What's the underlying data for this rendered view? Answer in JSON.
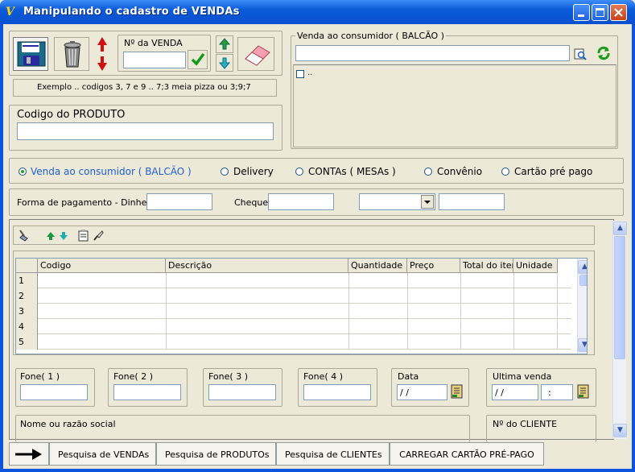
{
  "window": {
    "title": "Manipulando o cadastro de VENDAs",
    "app_icon": "vfp-icon",
    "controls": [
      "minimize",
      "maximize",
      "close"
    ]
  },
  "toolbar": {
    "venda_label": "Nº da VENDA",
    "venda_value": "",
    "hint": "Exemplo .. codigos 3, 7 e 9  ..  7;3 meia pizza ou 3;9;7"
  },
  "produto": {
    "label": "Codigo do PRODUTO",
    "value": ""
  },
  "consumidor": {
    "group_label": "Venda ao consumidor ( BALCÃO )",
    "value": "",
    "checkbox_label": ".."
  },
  "tipo_venda": {
    "options": [
      {
        "label": "Venda  ao  consumidor ( BALCÃO )",
        "selected": true
      },
      {
        "label": "Delivery",
        "selected": false
      },
      {
        "label": "CONTAs ( MESAs )",
        "selected": false
      },
      {
        "label": "Convênio",
        "selected": false
      },
      {
        "label": "Cartão  pré  pago",
        "selected": false
      }
    ]
  },
  "pagamento": {
    "dinheiro_label": "Forma  de  pagamento - Dinheiro",
    "dinheiro_value": "",
    "cheque_label": "Cheque",
    "cheque_value": "",
    "combo_value": "",
    "extra_value": ""
  },
  "grid": {
    "columns": [
      "Codigo",
      "Descrição",
      "Quantidade",
      "Preço",
      "Total do item",
      "Unidade"
    ],
    "rows": [
      "1",
      "2",
      "3",
      "4",
      "5"
    ]
  },
  "fones": [
    {
      "label": "Fone( 1 )",
      "value": ""
    },
    {
      "label": "Fone( 2 )",
      "value": ""
    },
    {
      "label": "Fone( 3 )",
      "value": ""
    },
    {
      "label": "Fone( 4 )",
      "value": ""
    }
  ],
  "data": {
    "label": "Data",
    "value": " / /"
  },
  "ultima_venda": {
    "label": "Ultima venda",
    "date": " / /",
    "time": ":"
  },
  "cliente": {
    "nome_label": "Nome  ou  razão  social",
    "numero_label": "Nº  do  CLIENTE"
  },
  "tabs": [
    {
      "label": "Pesquisa  de  VENDAs"
    },
    {
      "label": "Pesquisa  de  PRODUTOs"
    },
    {
      "label": "Pesquisa  de  CLIENTEs"
    },
    {
      "label": "CARREGAR  CARTÃO  PRÉ-PAGO"
    }
  ],
  "colors": {
    "titlebar": "#0b5bd8",
    "selected_radio_text": "#1f5fd0",
    "refresh_icon": "#1c9a1c"
  }
}
